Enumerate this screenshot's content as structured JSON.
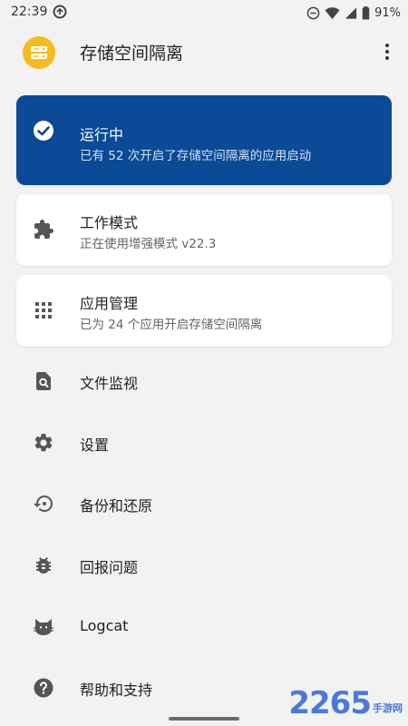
{
  "status_bar": {
    "time": "22:39",
    "battery": "91%"
  },
  "app_bar": {
    "title": "存储空间隔离"
  },
  "status_card": {
    "title": "运行中",
    "subtitle": "已有 52 次开启了存储空间隔离的应用启动",
    "icon": "check-circle-icon",
    "color": "#0a4a96"
  },
  "mode_card": {
    "title": "工作模式",
    "subtitle": "正在使用增强模式 v22.3",
    "icon": "puzzle-icon"
  },
  "apps_card": {
    "title": "应用管理",
    "subtitle": "已为 24 个应用开启存储空间隔离",
    "icon": "apps-grid-icon"
  },
  "menu": [
    {
      "label": "文件监视",
      "icon": "file-search-icon"
    },
    {
      "label": "设置",
      "icon": "gear-icon"
    },
    {
      "label": "备份和还原",
      "icon": "restore-icon"
    },
    {
      "label": "回报问题",
      "icon": "bug-icon"
    },
    {
      "label": "Logcat",
      "icon": "cat-icon"
    },
    {
      "label": "帮助和支持",
      "icon": "help-icon"
    }
  ],
  "watermark": {
    "number": "2265",
    "text": "手游网"
  }
}
